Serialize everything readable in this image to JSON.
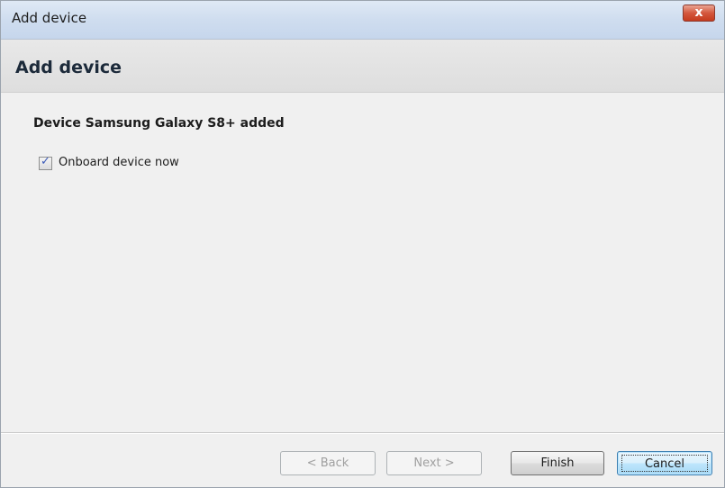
{
  "window": {
    "title": "Add device",
    "close_glyph": "x"
  },
  "header": {
    "heading": "Add device"
  },
  "content": {
    "message": "Device Samsung Galaxy S8+ added",
    "onboard_checkbox": {
      "label": "Onboard device now",
      "checked": true,
      "check_glyph": "✓"
    }
  },
  "footer": {
    "back_label": "< Back",
    "next_label": "Next >",
    "finish_label": "Finish",
    "cancel_label": "Cancel"
  },
  "icons": {
    "close": "close-icon",
    "check": "checkmark-icon"
  },
  "colors": {
    "close_button": "#c53b1e",
    "default_button_border": "#3c7fb1",
    "checkmark": "#3b5bb8",
    "disabled_text": "#a0a0a0"
  }
}
